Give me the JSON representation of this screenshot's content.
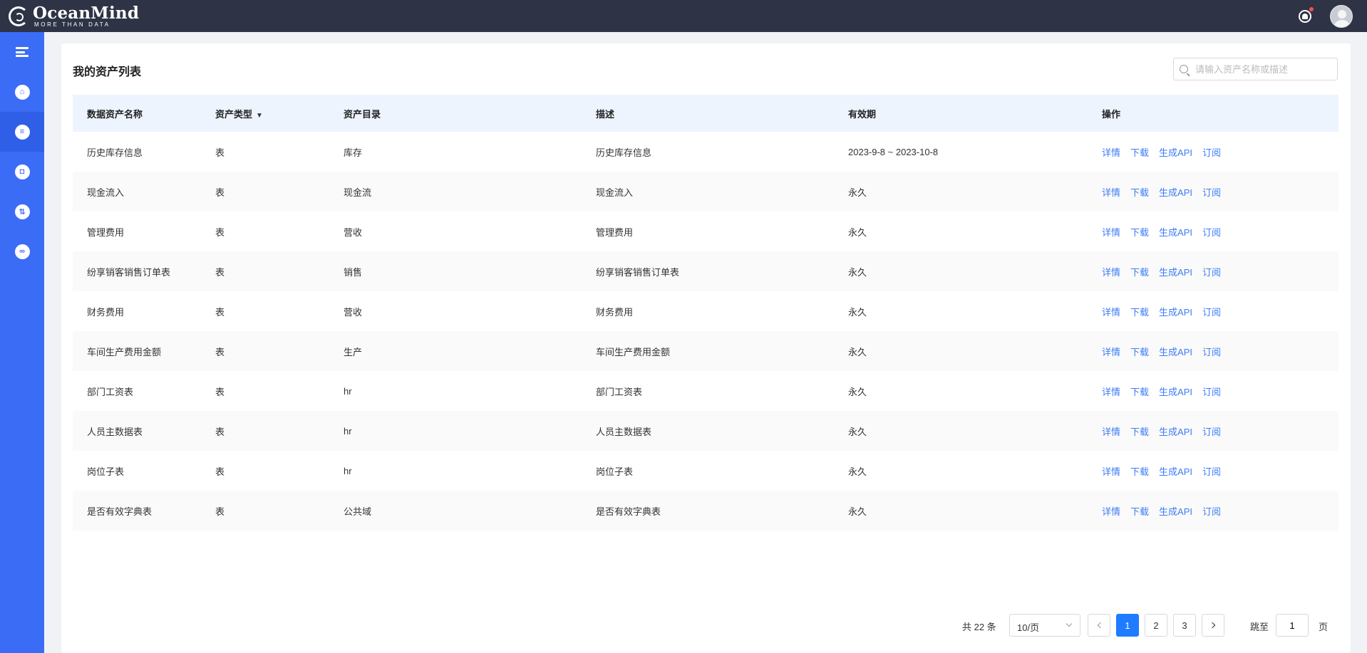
{
  "header": {
    "brand_name": "OceanMind",
    "brand_tagline": "MORE THAN DATA"
  },
  "sidebar": {
    "items": [
      {
        "icon": "menu-icon"
      },
      {
        "icon": "home-icon"
      },
      {
        "icon": "database-icon",
        "active": true
      },
      {
        "icon": "shield-icon"
      },
      {
        "icon": "sliders-icon"
      },
      {
        "icon": "link-icon"
      }
    ]
  },
  "page": {
    "title": "我的资产列表",
    "search_placeholder": "请输入资产名称或描述"
  },
  "table": {
    "columns": [
      "数据资产名称",
      "资产类型",
      "资产目录",
      "描述",
      "有效期",
      "操作"
    ],
    "actions": [
      "详情",
      "下载",
      "生成API",
      "订阅"
    ],
    "rows": [
      {
        "name": "历史库存信息",
        "type": "表",
        "catalog": "库存",
        "desc": "历史库存信息",
        "validity": "2023-9-8 ~ 2023-10-8"
      },
      {
        "name": "现金流入",
        "type": "表",
        "catalog": "现金流",
        "desc": "现金流入",
        "validity": "永久"
      },
      {
        "name": "管理费用",
        "type": "表",
        "catalog": "营收",
        "desc": "管理费用",
        "validity": "永久"
      },
      {
        "name": "纷享销客销售订单表",
        "type": "表",
        "catalog": "销售",
        "desc": "纷享销客销售订单表",
        "validity": "永久"
      },
      {
        "name": "财务费用",
        "type": "表",
        "catalog": "营收",
        "desc": "财务费用",
        "validity": "永久"
      },
      {
        "name": "车间生产费用金额",
        "type": "表",
        "catalog": "生产",
        "desc": "车间生产费用金额",
        "validity": "永久"
      },
      {
        "name": "部门工资表",
        "type": "表",
        "catalog": "hr",
        "desc": "部门工资表",
        "validity": "永久"
      },
      {
        "name": "人员主数据表",
        "type": "表",
        "catalog": "hr",
        "desc": "人员主数据表",
        "validity": "永久"
      },
      {
        "name": "岗位子表",
        "type": "表",
        "catalog": "hr",
        "desc": "岗位子表",
        "validity": "永久"
      },
      {
        "name": "是否有效字典表",
        "type": "表",
        "catalog": "公共域",
        "desc": "是否有效字典表",
        "validity": "永久"
      }
    ]
  },
  "pagination": {
    "total_text": "共 22 条",
    "page_size": "10/页",
    "pages": [
      "1",
      "2",
      "3"
    ],
    "current_page": "1",
    "jump_label": "跳至",
    "jump_value": "1",
    "page_suffix": "页"
  }
}
